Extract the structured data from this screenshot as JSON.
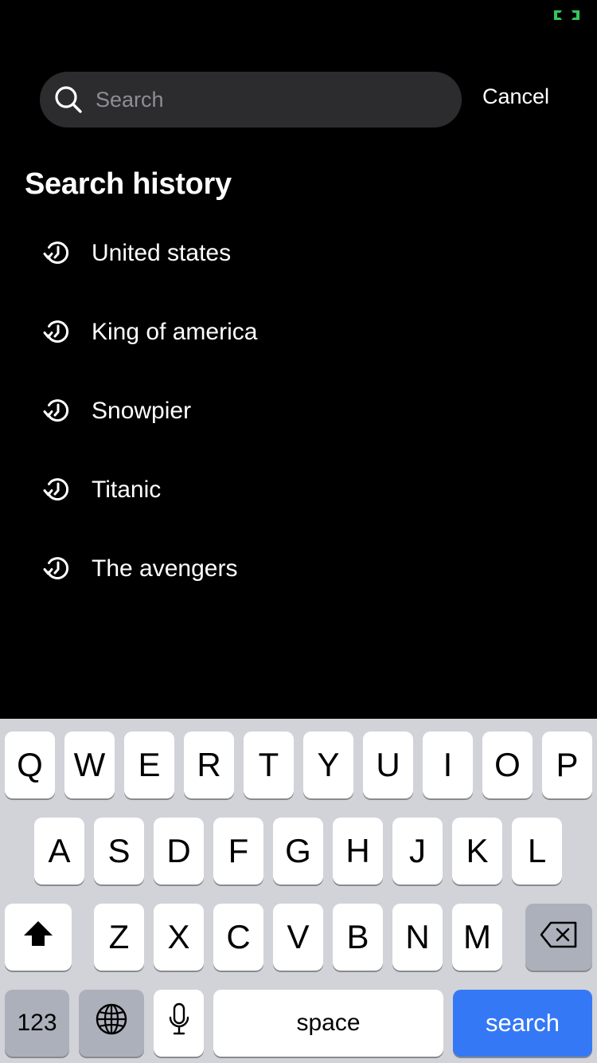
{
  "status": {
    "indicator_icon": "battery-charging-icon",
    "indicator_color": "#34c759"
  },
  "search": {
    "placeholder": "Search",
    "value": "",
    "icon": "search-icon",
    "cancel_label": "Cancel"
  },
  "history": {
    "title": "Search history",
    "icon": "history-icon",
    "items": [
      {
        "label": "United states"
      },
      {
        "label": "King of america"
      },
      {
        "label": "Snowpier"
      },
      {
        "label": "Titanic"
      },
      {
        "label": "The avengers"
      }
    ]
  },
  "keyboard": {
    "row1": [
      "Q",
      "W",
      "E",
      "R",
      "T",
      "Y",
      "U",
      "I",
      "O",
      "P"
    ],
    "row2": [
      "A",
      "S",
      "D",
      "F",
      "G",
      "H",
      "J",
      "K",
      "L"
    ],
    "row3": [
      "Z",
      "X",
      "C",
      "V",
      "B",
      "N",
      "M"
    ],
    "numbers_label": "123",
    "space_label": "space",
    "search_label": "search",
    "shift_icon": "shift-icon",
    "delete_icon": "backspace-icon",
    "globe_icon": "globe-icon",
    "mic_icon": "microphone-icon",
    "accent_color": "#3478f6"
  }
}
